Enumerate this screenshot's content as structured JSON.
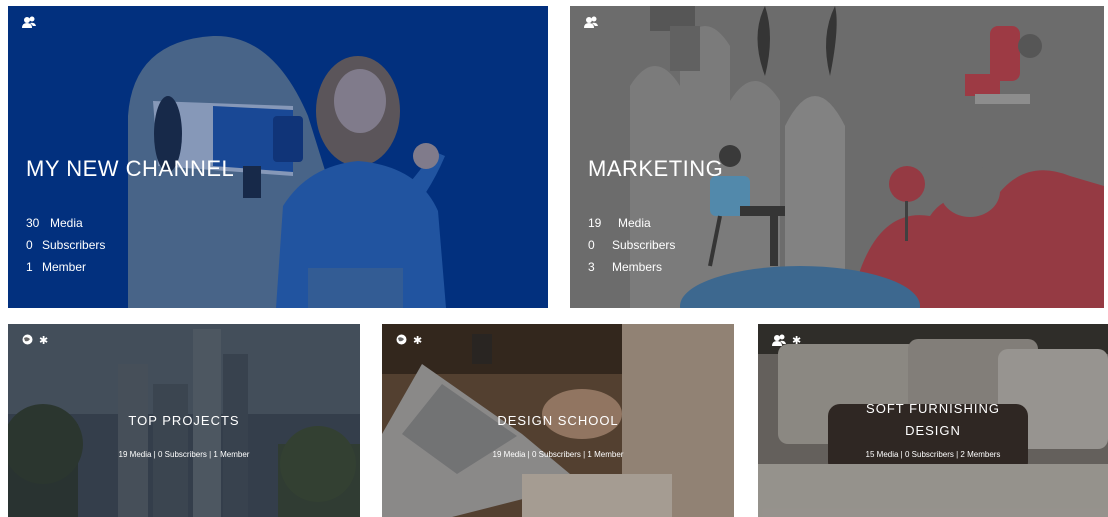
{
  "channels": [
    {
      "title": "MY NEW CHANNEL",
      "stats": [
        {
          "num": "30",
          "label": "Media"
        },
        {
          "num": "0",
          "label": "Subscribers"
        },
        {
          "num": "1",
          "label": "Member"
        }
      ],
      "icon": "members-icon"
    },
    {
      "title": "MARKETING",
      "stats": [
        {
          "num": "19",
          "label": "Media"
        },
        {
          "num": "0",
          "label": "Subscribers"
        },
        {
          "num": "3",
          "label": "Members"
        }
      ],
      "icon": "members-icon"
    },
    {
      "title": "TOP PROJECTS",
      "stats_line": "19 Media |  0 Subscribers   |   1 Member",
      "icons": [
        "globe-icon",
        "star-icon"
      ]
    },
    {
      "title": "DESIGN SCHOOL",
      "stats_line": "19 Media |  0 Subscribers   |   1 Member",
      "icons": [
        "globe-icon",
        "star-icon"
      ]
    },
    {
      "title_line1": "SOFT FURNISHING",
      "title_line2": "DESIGN",
      "stats_line": "15 Media |  0 Subscribers   |   2 Members",
      "icons": [
        "members-icon",
        "star-icon"
      ]
    }
  ],
  "colors": {
    "channel1_bg": "#003a86",
    "marketing_bg": "#6b6b6b",
    "accent_red": "#c8102e"
  }
}
